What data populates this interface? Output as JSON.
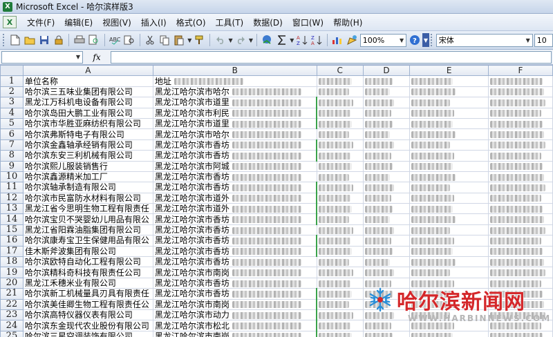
{
  "window": {
    "title": "Microsoft Excel - 哈尔滨样版3",
    "app_icon_glyph": "X"
  },
  "menu": {
    "icon_glyph": "X",
    "items": [
      "文件(F)",
      "编辑(E)",
      "视图(V)",
      "插入(I)",
      "格式(O)",
      "工具(T)",
      "数据(D)",
      "窗口(W)",
      "帮助(H)"
    ]
  },
  "toolbar": {
    "zoom": "100%",
    "font_name": "宋体",
    "font_size": "10"
  },
  "formula_bar": {
    "fx_label": "fx",
    "name_box": "",
    "formula": ""
  },
  "sheet": {
    "columns": [
      "A",
      "B",
      "C",
      "D",
      "E",
      "F"
    ],
    "header_row": {
      "a": "单位名称",
      "b": "地址"
    },
    "rows": [
      {
        "n": "1",
        "a": "单位名称",
        "b": "地址",
        "flag": false
      },
      {
        "n": "2",
        "a": "哈尔滨三五味业集团有限公司",
        "b": "黑龙江哈尔滨市哈尔",
        "flag": false
      },
      {
        "n": "3",
        "a": "黑龙江万科机电设备有限公司",
        "b": "黑龙江哈尔滨市道里",
        "flag": true
      },
      {
        "n": "4",
        "a": "哈尔滨岛田大鹏工业有限公司",
        "b": "黑龙江哈尔滨市利民",
        "flag": true
      },
      {
        "n": "5",
        "a": "哈尔滨市华胜亚麻纺织有限公司",
        "b": "黑龙江哈尔滨市道里",
        "flag": true
      },
      {
        "n": "6",
        "a": "哈尔滨弗斯特电子有限公司",
        "b": "黑龙江哈尔滨市哈尔",
        "flag": false
      },
      {
        "n": "7",
        "a": "哈尔滨金鑫轴承经销有限公司",
        "b": "黑龙江哈尔滨市香坊",
        "flag": true
      },
      {
        "n": "8",
        "a": "哈尔滨东安三利机械有限公司",
        "b": "黑龙江哈尔滨市香坊",
        "flag": true
      },
      {
        "n": "9",
        "a": "哈尔滨熙儿服装销售行",
        "b": "黑龙江哈尔滨市阿城",
        "flag": false
      },
      {
        "n": "10",
        "a": "哈尔滨鑫源精米加工厂",
        "b": "黑龙江哈尔滨市香坊",
        "flag": false
      },
      {
        "n": "11",
        "a": "哈尔滨轴承制造有限公司",
        "b": "黑龙江哈尔滨市香坊",
        "flag": true
      },
      {
        "n": "12",
        "a": "哈尔滨市民富防水材料有限公司",
        "b": "黑龙江哈尔滨市道外",
        "flag": true
      },
      {
        "n": "13",
        "a": "黑龙江省今思明生物工程有限责任",
        "b": "黑龙江哈尔滨市道外",
        "flag": true
      },
      {
        "n": "14",
        "a": "哈尔滨宝贝不哭婴幼儿用品有限公",
        "b": "黑龙江哈尔滨市香坊",
        "flag": true
      },
      {
        "n": "15",
        "a": "黑龙江省阳霖油脂集团有限公司",
        "b": "黑龙江哈尔滨市香坊",
        "flag": false
      },
      {
        "n": "16",
        "a": "哈尔滨康寿宝卫生保健用品有限公",
        "b": "黑龙江哈尔滨市香坊",
        "flag": true
      },
      {
        "n": "17",
        "a": "佳木斯斧波集团有限公司",
        "b": "黑龙江哈尔滨市香坊",
        "flag": true
      },
      {
        "n": "18",
        "a": "哈尔滨欧特自动化工程有限公司",
        "b": "黑龙江哈尔滨市香坊",
        "flag": false
      },
      {
        "n": "19",
        "a": "哈尔滨精科奇科技有限责任公司",
        "b": "黑龙江哈尔滨市南岗",
        "flag": false
      },
      {
        "n": "20",
        "a": "黑龙江禾穗米业有限公司",
        "b": "黑龙江哈尔滨市香坊",
        "flag": false
      },
      {
        "n": "21",
        "a": "哈尔滨新工机械量具刃具有限责任",
        "b": "黑龙江哈尔滨市香坊",
        "flag": true
      },
      {
        "n": "22",
        "a": "哈尔滨美佳卿生物工程有限责任公",
        "b": "黑龙江哈尔滨市南岗",
        "flag": true
      },
      {
        "n": "23",
        "a": "哈尔滨高特仪器仪表有限公司",
        "b": "黑龙江哈尔滨市动力",
        "flag": true
      },
      {
        "n": "24",
        "a": "哈尔滨东金现代农业股份有限公司",
        "b": "黑龙江哈尔滨市松北",
        "flag": true
      },
      {
        "n": "25",
        "a": "哈尔滨三星空调装饰有限公司",
        "b": "黑龙江哈尔滨市南岗",
        "flag": true
      }
    ]
  },
  "watermark": {
    "text": "哈尔滨新闻网",
    "url": "WWW.HARBINNEWS.COM",
    "color": "#d4272a"
  }
}
